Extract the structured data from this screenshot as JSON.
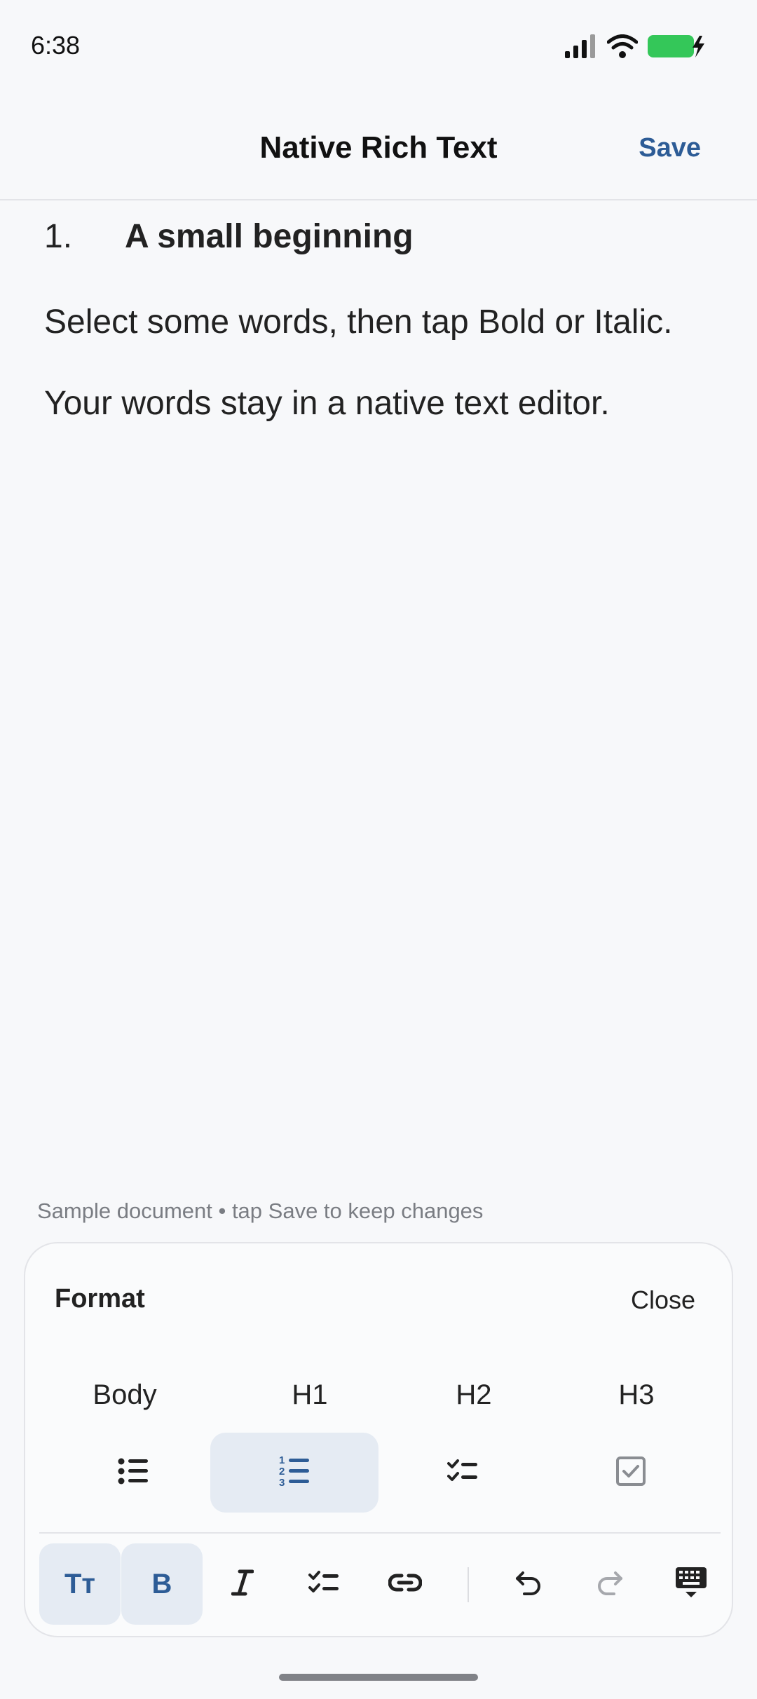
{
  "status_bar": {
    "time": "6:38",
    "icons": [
      "signal-icon",
      "wifi-icon",
      "battery-charging-icon"
    ]
  },
  "nav": {
    "title": "Native Rich Text",
    "save_label": "Save"
  },
  "document": {
    "heading": {
      "number": "1.",
      "text": "A small beginning"
    },
    "paragraphs": [
      "Select some words, then tap Bold or Italic.",
      "Your words stay in a native text editor."
    ]
  },
  "hint": "Sample document • tap Save to keep changes",
  "format_panel": {
    "title": "Format",
    "close_label": "Close",
    "styles": [
      "Body",
      "H1",
      "H2",
      "H3"
    ],
    "list_buttons": [
      {
        "icon": "bullet-list-icon",
        "active": false
      },
      {
        "icon": "numbered-list-icon",
        "active": true
      },
      {
        "icon": "checklist-icon",
        "active": false
      },
      {
        "icon": "checkbox-icon",
        "active": false
      }
    ]
  },
  "toolbar": {
    "text_size_label": "Tт",
    "bold_label": "B",
    "buttons": [
      {
        "icon": "text-size-icon",
        "active": true
      },
      {
        "icon": "bold-icon",
        "active": true
      },
      {
        "icon": "italic-icon",
        "active": false
      },
      {
        "icon": "checklist-icon",
        "active": false
      },
      {
        "icon": "link-icon",
        "active": false
      },
      {
        "icon": "undo-icon",
        "active": false
      },
      {
        "icon": "redo-icon",
        "active": false,
        "disabled": true
      },
      {
        "icon": "keyboard-dismiss-icon",
        "active": false
      }
    ]
  },
  "colors": {
    "accent": "#2d5c96",
    "active_background": "#e5ebf3",
    "background": "#f7f8fa",
    "battery": "#34c759"
  }
}
